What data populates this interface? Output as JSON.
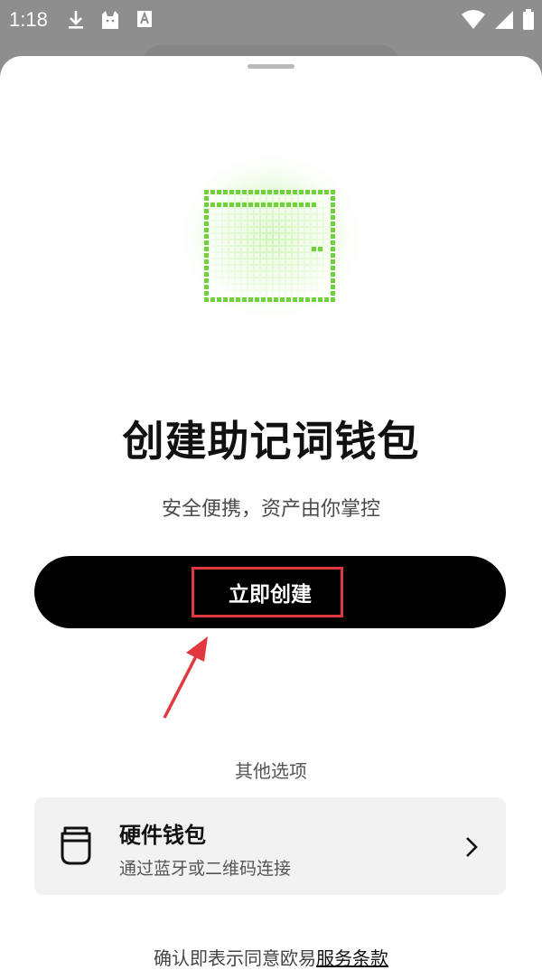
{
  "status_bar": {
    "time": "1:18",
    "left_icons": [
      "download-icon",
      "cat-app-icon",
      "text-a-icon"
    ],
    "right_icons": [
      "wifi-icon",
      "signal-icon",
      "battery-icon"
    ]
  },
  "sheet": {
    "illustration": "pixel-wallet-icon",
    "accent_color": "#6fd13c",
    "title": "创建助记词钱包",
    "subtitle": "安全便携，资产由你掌控",
    "primary_button": "立即创建",
    "other_options_label": "其他选项",
    "hardware_wallet": {
      "title": "硬件钱包",
      "description": "通过蓝牙或二维码连接",
      "icon": "hardware-wallet-icon"
    },
    "terms_prefix": "确认即表示同意欧易",
    "terms_link": "服务条款"
  },
  "annotation": {
    "highlight_color": "#e0383e"
  }
}
